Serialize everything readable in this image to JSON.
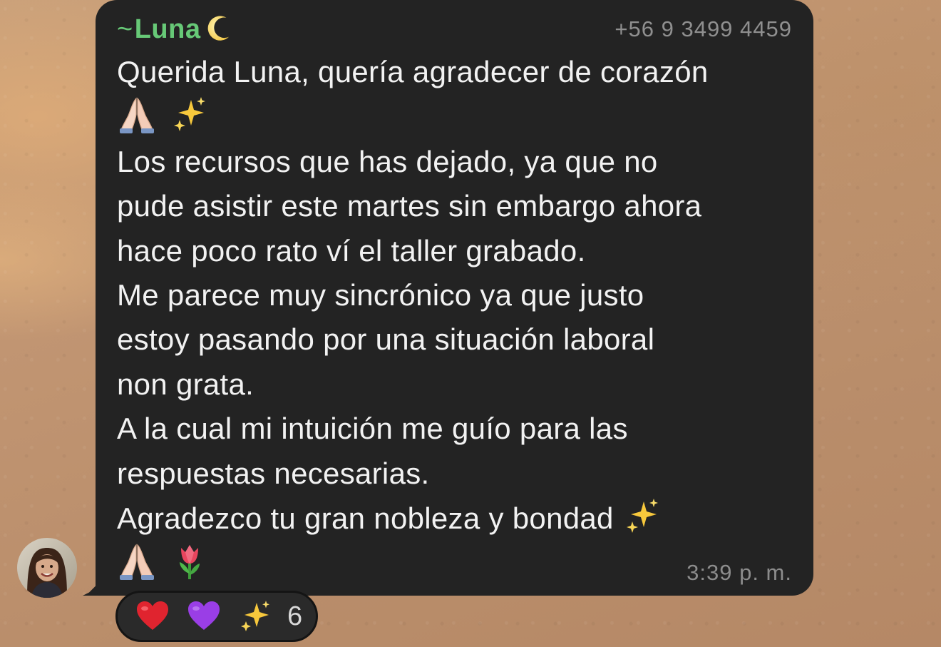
{
  "message": {
    "sender_prefix": "~",
    "sender_name": "Luna",
    "sender_icon": "crescent-moon-icon",
    "sender_phone": "+56 9 3499 4459",
    "lines": [
      "Querida Luna, quería agradecer de corazón",
      "Los recursos que has dejado, ya que no",
      "pude asistir este martes sin embargo ahora",
      "hace poco rato ví el taller grabado.",
      "Me parece muy sincrónico ya que justo",
      "estoy pasando por una situación laboral",
      "non grata.",
      "A la cual mi intuición me guío para las",
      "respuestas necesarias.",
      "Agradezco tu gran nobleza y bondad"
    ],
    "time": "3:39 p. m."
  },
  "reactions": {
    "emojis": [
      "red-heart-icon",
      "purple-heart-icon",
      "sparkles-icon"
    ],
    "count": "6"
  },
  "colors": {
    "bubble": "#232323",
    "sender_name": "#67c977",
    "meta_text": "#8f8f8f",
    "body_text": "#f2f2f2"
  }
}
